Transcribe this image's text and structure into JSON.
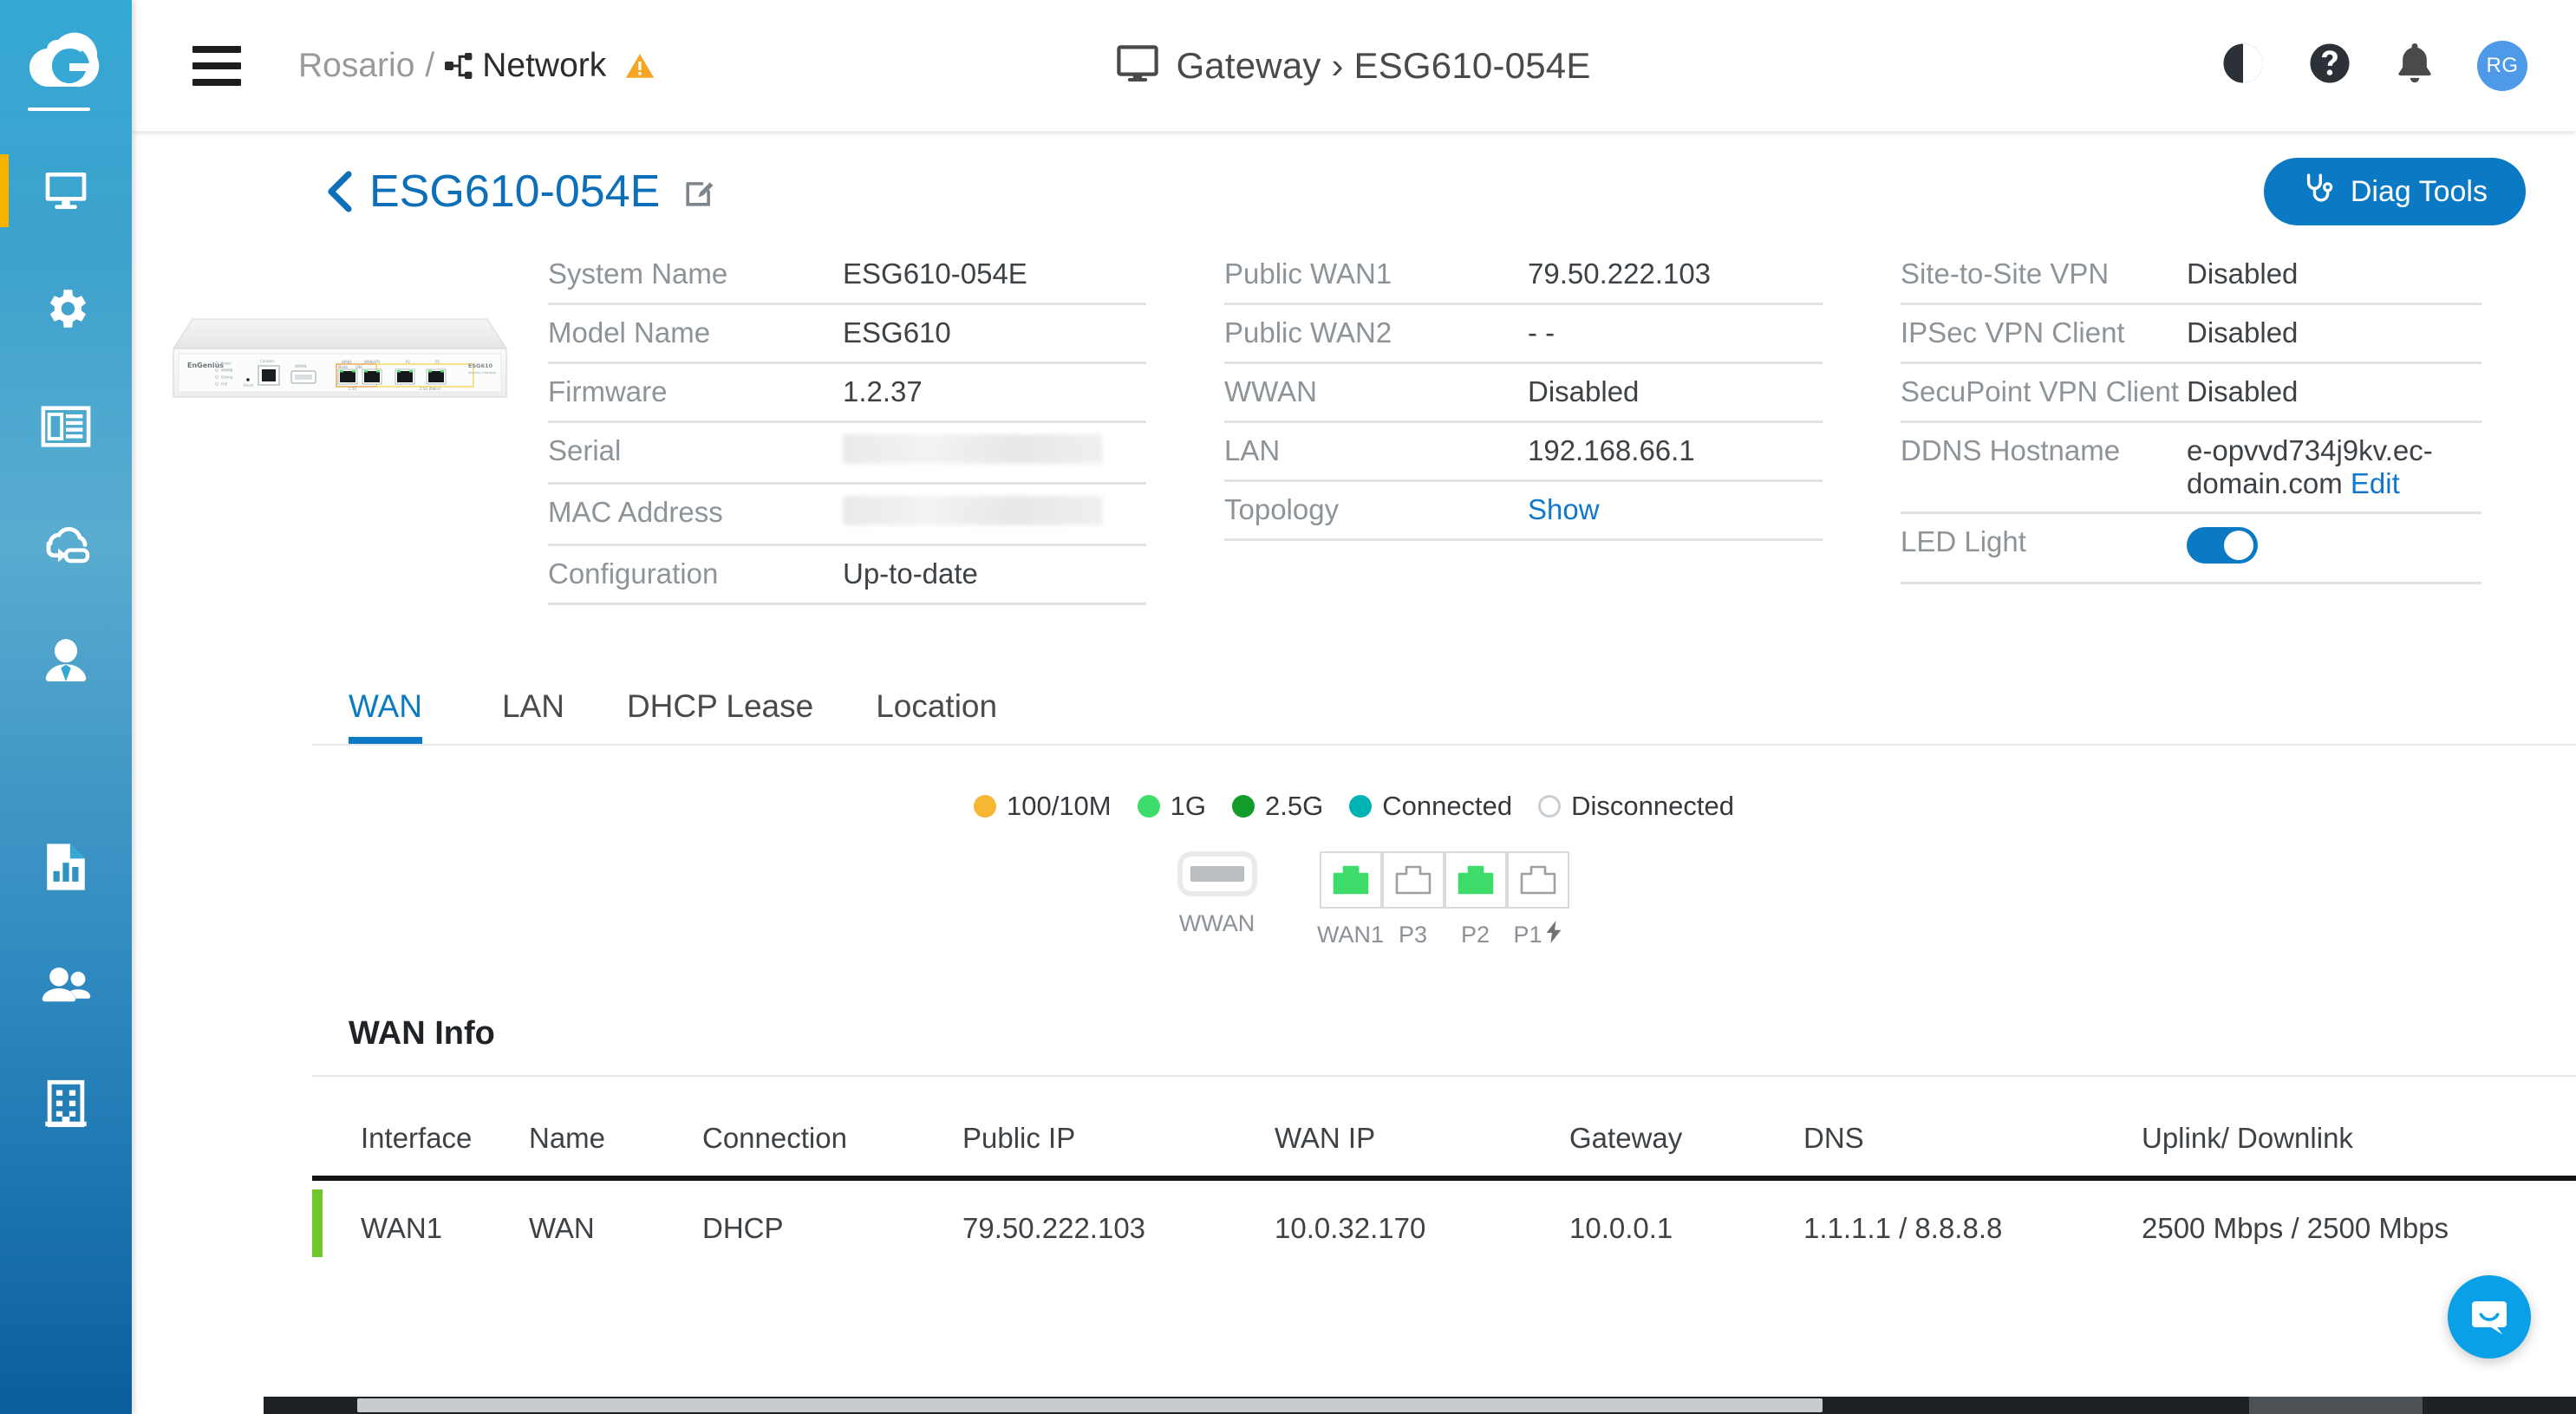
{
  "brand": {
    "logo_letter": "G",
    "accent": "#0b79c4",
    "sidebar_top": "#35a8d4",
    "sidebar_bottom": "#0a5e9c",
    "active_marker": "#f5b400"
  },
  "topbar": {
    "menu_icon": "hamburger-icon",
    "breadcrumb": {
      "site": "Rosario",
      "separator": "/",
      "network_icon": "network-topology-icon",
      "network": "Network",
      "warning_icon": "warning-triangle-icon"
    },
    "center_icon": "monitor-icon",
    "center_title": "Gateway › ESG610-054E",
    "right_icons": [
      {
        "name": "contrast-icon",
        "label": "Theme"
      },
      {
        "name": "help-icon",
        "label": "Help"
      },
      {
        "name": "bell-icon",
        "label": "Notifications"
      }
    ],
    "avatar_initials": "RG"
  },
  "sidebar": {
    "items": [
      {
        "name": "sidebar-item-devices",
        "icon": "monitor-icon",
        "active": true
      },
      {
        "name": "sidebar-item-configure",
        "icon": "gear-icon",
        "active": false
      },
      {
        "name": "sidebar-item-dashboard",
        "icon": "layout-panel-icon",
        "active": false
      },
      {
        "name": "sidebar-item-cloud-backup",
        "icon": "cloud-sync-icon",
        "active": false
      },
      {
        "name": "sidebar-item-clients",
        "icon": "user-tie-icon",
        "active": false
      },
      {
        "name": "sidebar-item-reports",
        "icon": "report-chart-icon",
        "active": false
      },
      {
        "name": "sidebar-item-users",
        "icon": "people-icon",
        "active": false
      },
      {
        "name": "sidebar-item-organization",
        "icon": "building-icon",
        "active": false
      }
    ]
  },
  "device_header": {
    "back_icon": "chevron-left-icon",
    "title": "ESG610-054E",
    "edit_icon": "edit-pencil-icon",
    "diag_button": {
      "label": "Diag Tools",
      "icon": "stethoscope-icon"
    }
  },
  "device_image": {
    "name": "esg610-front-panel-image",
    "brand_text": "EnGenius",
    "model_text": "ESG610",
    "model_sub": "Security Gateway",
    "leds": [
      "Power",
      "WWAN",
      "Debug",
      "PoE"
    ],
    "labels": [
      "Reset",
      "Console",
      "WWAN"
    ],
    "port_group_labels": [
      "WAN1",
      "WAN2/P3",
      "P2",
      "P1"
    ],
    "port_speed_labels": [
      "2.5G",
      "2.5G (PoE+)"
    ],
    "mode_labels": [
      "Mode",
      "LNK"
    ]
  },
  "info": {
    "col1": [
      {
        "label": "System Name",
        "value": "ESG610-054E",
        "type": "text"
      },
      {
        "label": "Model Name",
        "value": "ESG610",
        "type": "text"
      },
      {
        "label": "Firmware",
        "value": "1.2.37",
        "type": "text"
      },
      {
        "label": "Serial",
        "value": "",
        "type": "redacted"
      },
      {
        "label": "MAC Address",
        "value": "",
        "type": "redacted"
      },
      {
        "label": "Configuration",
        "value": "Up-to-date",
        "type": "text"
      }
    ],
    "col2": [
      {
        "label": "Public WAN1",
        "value": "79.50.222.103",
        "type": "text"
      },
      {
        "label": "Public WAN2",
        "value": "- -",
        "type": "text"
      },
      {
        "label": "WWAN",
        "value": "Disabled",
        "type": "text"
      },
      {
        "label": "LAN",
        "value": "192.168.66.1",
        "type": "text"
      },
      {
        "label": "Topology",
        "value": "Show",
        "type": "link"
      }
    ],
    "col3": [
      {
        "label": "Site-to-Site VPN",
        "value": "Disabled",
        "type": "text"
      },
      {
        "label": "IPSec VPN Client",
        "value": "Disabled",
        "type": "text"
      },
      {
        "label": "SecuPoint VPN Client",
        "value": "Disabled",
        "type": "text"
      },
      {
        "label": "DDNS Hostname",
        "value": "e-opvvd734j9kv.ec-domain.com",
        "link_label": "Edit",
        "type": "text_with_link"
      },
      {
        "label": "LED Light",
        "value": "On",
        "type": "toggle"
      }
    ]
  },
  "tabs": [
    {
      "label": "WAN",
      "active": true
    },
    {
      "label": "LAN",
      "active": false
    },
    {
      "label": "DHCP Lease",
      "active": false
    },
    {
      "label": "Location",
      "active": false
    }
  ],
  "port_legend": [
    {
      "label": "100/10M",
      "color": "#f7b733",
      "style": "solid"
    },
    {
      "label": "1G",
      "color": "#3ddc6b",
      "style": "solid"
    },
    {
      "label": "2.5G",
      "color": "#129d2b",
      "style": "solid"
    },
    {
      "label": "Connected",
      "color": "#00b2b2",
      "style": "solid"
    },
    {
      "label": "Disconnected",
      "color": "#ffffff",
      "style": "hollow"
    }
  ],
  "port_diagram": {
    "wwan": {
      "label": "WWAN",
      "state": "disconnected"
    },
    "ethernet": [
      {
        "label": "WAN1",
        "state": "connected",
        "color": "#3ddc6b",
        "poe": false
      },
      {
        "label": "P3",
        "state": "disconnected",
        "color": "#ffffff",
        "poe": false
      },
      {
        "label": "P2",
        "state": "connected",
        "color": "#3ddc6b",
        "poe": false
      },
      {
        "label": "P1",
        "state": "disconnected",
        "color": "#ffffff",
        "poe": true
      }
    ]
  },
  "wan_info": {
    "title": "WAN Info",
    "columns": [
      "Interface",
      "Name",
      "Connection",
      "Public IP",
      "WAN IP",
      "Gateway",
      "DNS",
      "Uplink/ Downlink"
    ],
    "rows": [
      {
        "status_color": "#6fc72b",
        "interface": "WAN1",
        "name": "WAN",
        "connection": "DHCP",
        "public_ip": "79.50.222.103",
        "wan_ip": "10.0.32.170",
        "gateway": "10.0.0.1",
        "dns": "1.1.1.1 / 8.8.8.8",
        "uplink_downlink": "2500 Mbps / 2500 Mbps"
      }
    ]
  },
  "chat": {
    "icon": "chat-bubble-icon",
    "color": "#0aa0e8"
  }
}
